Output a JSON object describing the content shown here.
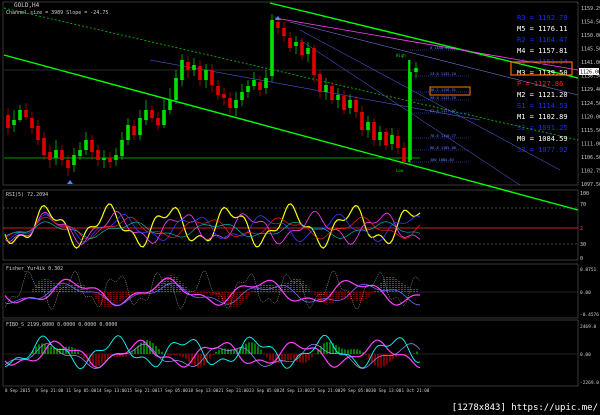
{
  "chart_title": "GOLD,H4",
  "indicator_note": "Channel size = 3989 Slope = -24.75",
  "price_panel": {
    "right_axis": [
      "1159.29",
      "1154.50",
      "1150.00",
      "1145.50",
      "1141.00",
      "1136.50",
      "1129.40",
      "1124.50",
      "1120.00",
      "1115.50",
      "1111.00",
      "1106.50",
      "1102.75",
      "1097.50"
    ],
    "current_price": "1126.00",
    "fib_labels": [
      "0  1140.45",
      "23.6  1132.24",
      "38.2  1126.51",
      "50.0  1122.29",
      "61.8  1117.47",
      "78.6  1110.77",
      "88.6  1105.00",
      "100  1084.63"
    ],
    "high_label": "High",
    "low_label": "Low",
    "pivots": [
      {
        "label": "R3 = 1192.79",
        "color": "#1a2cff"
      },
      {
        "label": "M5 = 1176.11",
        "color": "#ffffff"
      },
      {
        "label": "R2 = 1164.47",
        "color": "#1a2cff"
      },
      {
        "label": "M4 = 1157.81",
        "color": "#ffffff"
      },
      {
        "label": "R1 = 1151.14",
        "color": "#1a2cff"
      },
      {
        "label": "M3 = 1139.50",
        "color": "#ffffff"
      },
      {
        "label": "P = 1127.86",
        "color": "#ff2020"
      },
      {
        "label": "M2 = 1121.20",
        "color": "#ffffff"
      },
      {
        "label": "S1 = 1114.53",
        "color": "#1a2cff"
      },
      {
        "label": "M1 = 1102.89",
        "color": "#ffffff"
      },
      {
        "label": "S2 = 1091.25",
        "color": "#1a2cff"
      },
      {
        "label": "M0 = 1084.59",
        "color": "#ffffff"
      },
      {
        "label": "S3 = 1077.92",
        "color": "#1a2cff"
      }
    ]
  },
  "rsi_panel": {
    "title": "RSI(5) 72.2094",
    "level_70": "70",
    "level_30": "30",
    "right_axis": [
      "100",
      "70",
      "30",
      "0"
    ],
    "level_value": "2"
  },
  "fisher_panel": {
    "title": "Fisher_Yur4ik 0.302",
    "right_axis": [
      "0.8751",
      "0.00",
      "-0.4576"
    ]
  },
  "fibo_panel": {
    "title": "FIBO_S 2199.0000 0.0000 0.0000 0.0000",
    "right_axis": [
      "2469.0",
      "0.00",
      "-2269.0"
    ]
  },
  "time_axis": [
    "8 Sep 2015",
    "9 Sep 21:00",
    "11 Sep 05:00",
    "14 Sep 13:00",
    "15 Sep 21:00",
    "17 Sep 05:00",
    "18 Sep 13:00",
    "21 Sep 21:00",
    "23 Sep 05:00",
    "24 Sep 13:00",
    "25 Sep 21:00",
    "29 Sep 05:00",
    "30 Sep 13:00",
    "1 Oct 21:00"
  ],
  "watermark": "[1278x843] https://upic.me/",
  "colors": {
    "bull": "#00e000",
    "bear": "#e00000",
    "channel": "#00ff00",
    "pivot_box": "#ff6600"
  }
}
